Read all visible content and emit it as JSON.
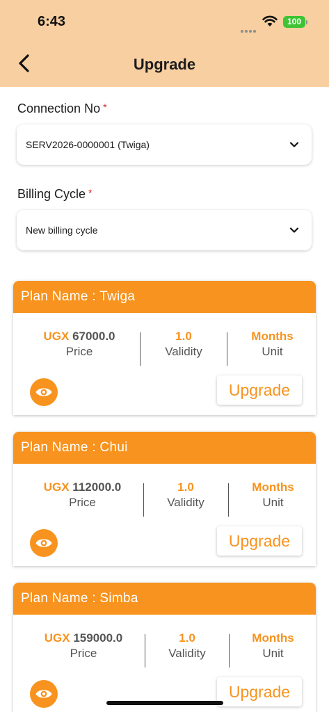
{
  "status_bar": {
    "time": "6:43",
    "battery": "100"
  },
  "nav": {
    "title": "Upgrade"
  },
  "form": {
    "connection": {
      "label": "Connection No",
      "required_mark": "*",
      "value": "SERV2026-0000001 (Twiga)"
    },
    "billing_cycle": {
      "label": "Billing Cycle",
      "required_mark": "*",
      "value": "New billing cycle"
    }
  },
  "plans": [
    {
      "header": "Plan Name : Twiga",
      "currency": "UGX",
      "price": "67000.0",
      "price_label": "Price",
      "validity": "1.0",
      "validity_label": "Validity",
      "unit": "Months",
      "unit_label": "Unit",
      "button": "Upgrade"
    },
    {
      "header": "Plan Name : Chui",
      "currency": "UGX",
      "price": "112000.0",
      "price_label": "Price",
      "validity": "1.0",
      "validity_label": "Validity",
      "unit": "Months",
      "unit_label": "Unit",
      "button": "Upgrade"
    },
    {
      "header": "Plan Name : Simba",
      "currency": "UGX",
      "price": "159000.0",
      "price_label": "Price",
      "validity": "1.0",
      "validity_label": "Validity",
      "unit": "Months",
      "unit_label": "Unit",
      "button": "Upgrade"
    }
  ],
  "colors": {
    "accent": "#f7931e",
    "header_bg": "#f7cfa0",
    "battery": "#3ec433"
  },
  "icons": {
    "back": "chevron-left-icon",
    "dropdown": "chevron-down-icon",
    "view": "eye-icon",
    "wifi": "wifi-icon"
  }
}
